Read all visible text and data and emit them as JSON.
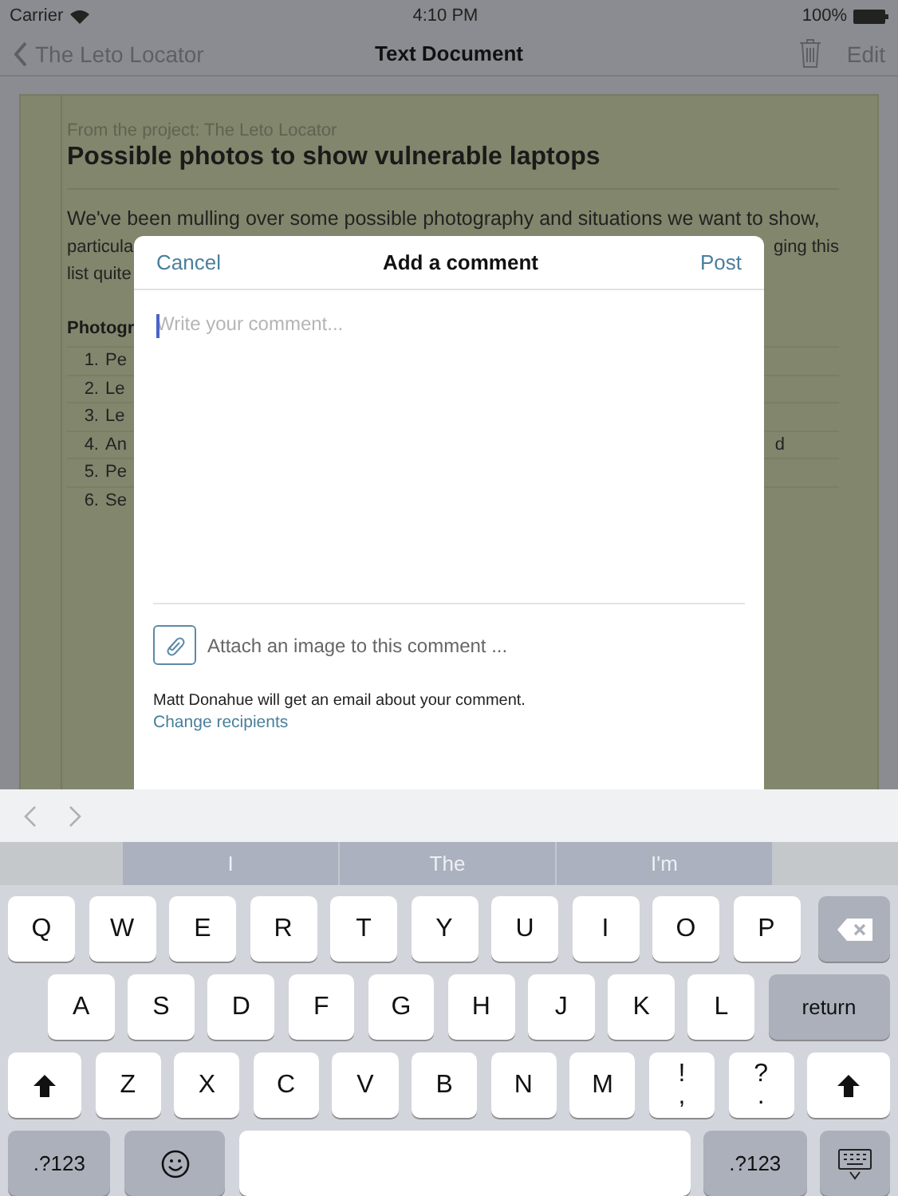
{
  "status_bar": {
    "carrier": "Carrier",
    "time": "4:10 PM",
    "battery": "100%"
  },
  "nav": {
    "back": "The Leto Locator",
    "title": "Text Document",
    "edit": "Edit"
  },
  "document": {
    "project_line": "From the project: The Leto Locator",
    "title": "Possible photos to show vulnerable laptops",
    "lines": [
      {
        "left": "We've been mulling over some possible photography and situations we want to show,"
      },
      {
        "left": "particula",
        "right": "ging this"
      },
      {
        "left": "list quite"
      }
    ],
    "section_heading": "Photogr",
    "items": [
      {
        "number": "1.",
        "text": "Pe"
      },
      {
        "number": "2.",
        "text": "Le"
      },
      {
        "number": "3.",
        "text": "Le"
      },
      {
        "number": "4.",
        "text": "An",
        "tail": "d"
      },
      {
        "number": "5.",
        "text": "Pe"
      },
      {
        "number": "6.",
        "text": "Se"
      }
    ]
  },
  "modal": {
    "cancel": "Cancel",
    "title": "Add a comment",
    "post": "Post",
    "placeholder": "Write your comment...",
    "attach": "Attach an image to this comment ...",
    "notice": "Matt Donahue will get an email about your comment.",
    "link": "Change recipients"
  },
  "keyboard": {
    "suggestions": [
      {
        "text": "I"
      },
      {
        "text": "The"
      },
      {
        "text": "I'm"
      }
    ],
    "rows": [
      [
        {
          "kind": "letter",
          "label": "Q"
        },
        {
          "kind": "letter",
          "label": "W"
        },
        {
          "kind": "letter",
          "label": "E"
        },
        {
          "kind": "letter",
          "label": "R"
        },
        {
          "kind": "letter",
          "label": "T"
        },
        {
          "kind": "letter",
          "label": "Y"
        },
        {
          "kind": "letter",
          "label": "U"
        },
        {
          "kind": "letter",
          "label": "I"
        },
        {
          "kind": "letter",
          "label": "O"
        },
        {
          "kind": "letter",
          "label": "P"
        },
        {
          "kind": "backspace"
        }
      ],
      [
        {
          "kind": "letter",
          "label": "A"
        },
        {
          "kind": "letter",
          "label": "S"
        },
        {
          "kind": "letter",
          "label": "D"
        },
        {
          "kind": "letter",
          "label": "F"
        },
        {
          "kind": "letter",
          "label": "G"
        },
        {
          "kind": "letter",
          "label": "H"
        },
        {
          "kind": "letter",
          "label": "J"
        },
        {
          "kind": "letter",
          "label": "K"
        },
        {
          "kind": "letter",
          "label": "L"
        },
        {
          "kind": "return",
          "label": "return"
        }
      ],
      [
        {
          "kind": "shift"
        },
        {
          "kind": "letter",
          "label": "Z"
        },
        {
          "kind": "letter",
          "label": "X"
        },
        {
          "kind": "letter",
          "label": "C"
        },
        {
          "kind": "letter",
          "label": "V"
        },
        {
          "kind": "letter",
          "label": "B"
        },
        {
          "kind": "letter",
          "label": "N"
        },
        {
          "kind": "letter",
          "label": "M"
        },
        {
          "kind": "dual",
          "label": "!",
          "sublabel": ","
        },
        {
          "kind": "dual",
          "label": "?",
          "sublabel": "."
        },
        {
          "kind": "shift"
        }
      ]
    ],
    "bottom_bar": {
      "numbers_left": ".?123",
      "numbers_right": ".?123"
    }
  }
}
